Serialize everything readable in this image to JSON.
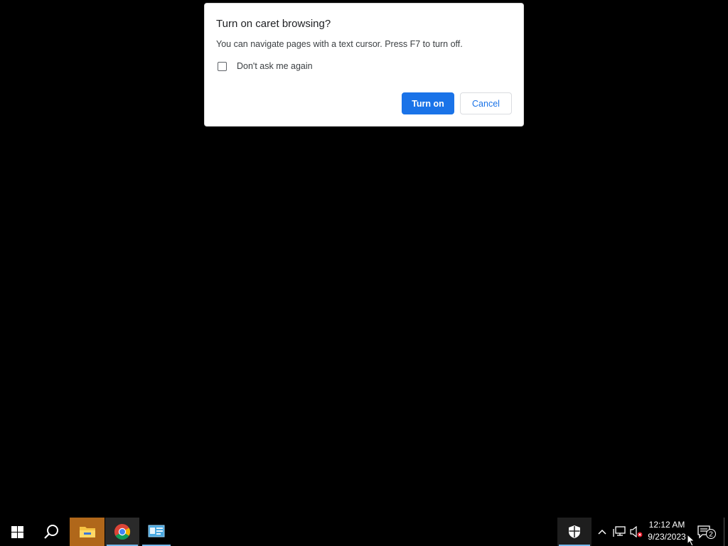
{
  "dialog": {
    "title": "Turn on caret browsing?",
    "message": "You can navigate pages with a text cursor. Press F7 to turn off.",
    "checkbox_label": "Don't ask me again",
    "checkbox_checked": false,
    "primary_button": "Turn on",
    "secondary_button": "Cancel"
  },
  "taskbar": {
    "pinned": [
      {
        "name": "start-button",
        "icon": "windows-logo-icon"
      },
      {
        "name": "search-button",
        "icon": "search-icon"
      },
      {
        "name": "file-explorer",
        "icon": "folder-icon"
      },
      {
        "name": "google-chrome",
        "icon": "chrome-icon"
      },
      {
        "name": "control-panel",
        "icon": "control-panel-icon"
      }
    ],
    "tray": {
      "time": "12:12 AM",
      "date": "9/23/2023",
      "notification_count": "2"
    }
  },
  "colors": {
    "accent": "#1a73e8",
    "desktop": "#000000",
    "explorer_highlight": "#b0671a"
  }
}
